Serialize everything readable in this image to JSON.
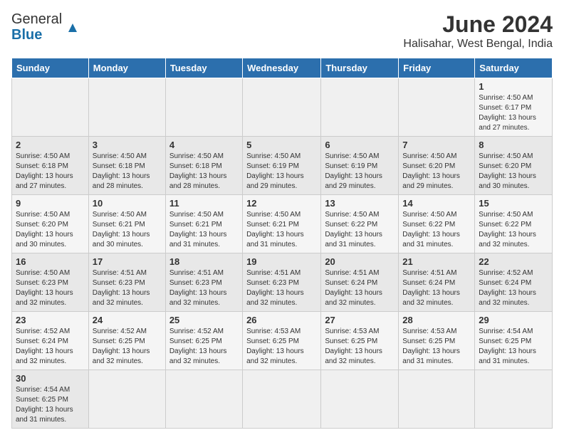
{
  "header": {
    "logo_line1": "General",
    "logo_line2": "Blue",
    "main_title": "June 2024",
    "subtitle": "Halisahar, West Bengal, India"
  },
  "weekdays": [
    "Sunday",
    "Monday",
    "Tuesday",
    "Wednesday",
    "Thursday",
    "Friday",
    "Saturday"
  ],
  "weeks": [
    [
      {
        "day": "",
        "info": ""
      },
      {
        "day": "",
        "info": ""
      },
      {
        "day": "",
        "info": ""
      },
      {
        "day": "",
        "info": ""
      },
      {
        "day": "",
        "info": ""
      },
      {
        "day": "",
        "info": ""
      },
      {
        "day": "1",
        "info": "Sunrise: 4:50 AM\nSunset: 6:17 PM\nDaylight: 13 hours\nand 27 minutes."
      }
    ],
    [
      {
        "day": "2",
        "info": "Sunrise: 4:50 AM\nSunset: 6:18 PM\nDaylight: 13 hours\nand 27 minutes."
      },
      {
        "day": "3",
        "info": "Sunrise: 4:50 AM\nSunset: 6:18 PM\nDaylight: 13 hours\nand 28 minutes."
      },
      {
        "day": "4",
        "info": "Sunrise: 4:50 AM\nSunset: 6:18 PM\nDaylight: 13 hours\nand 28 minutes."
      },
      {
        "day": "5",
        "info": "Sunrise: 4:50 AM\nSunset: 6:19 PM\nDaylight: 13 hours\nand 29 minutes."
      },
      {
        "day": "6",
        "info": "Sunrise: 4:50 AM\nSunset: 6:19 PM\nDaylight: 13 hours\nand 29 minutes."
      },
      {
        "day": "7",
        "info": "Sunrise: 4:50 AM\nSunset: 6:20 PM\nDaylight: 13 hours\nand 29 minutes."
      },
      {
        "day": "8",
        "info": "Sunrise: 4:50 AM\nSunset: 6:20 PM\nDaylight: 13 hours\nand 30 minutes."
      }
    ],
    [
      {
        "day": "9",
        "info": "Sunrise: 4:50 AM\nSunset: 6:20 PM\nDaylight: 13 hours\nand 30 minutes."
      },
      {
        "day": "10",
        "info": "Sunrise: 4:50 AM\nSunset: 6:21 PM\nDaylight: 13 hours\nand 30 minutes."
      },
      {
        "day": "11",
        "info": "Sunrise: 4:50 AM\nSunset: 6:21 PM\nDaylight: 13 hours\nand 31 minutes."
      },
      {
        "day": "12",
        "info": "Sunrise: 4:50 AM\nSunset: 6:21 PM\nDaylight: 13 hours\nand 31 minutes."
      },
      {
        "day": "13",
        "info": "Sunrise: 4:50 AM\nSunset: 6:22 PM\nDaylight: 13 hours\nand 31 minutes."
      },
      {
        "day": "14",
        "info": "Sunrise: 4:50 AM\nSunset: 6:22 PM\nDaylight: 13 hours\nand 31 minutes."
      },
      {
        "day": "15",
        "info": "Sunrise: 4:50 AM\nSunset: 6:22 PM\nDaylight: 13 hours\nand 32 minutes."
      }
    ],
    [
      {
        "day": "16",
        "info": "Sunrise: 4:50 AM\nSunset: 6:23 PM\nDaylight: 13 hours\nand 32 minutes."
      },
      {
        "day": "17",
        "info": "Sunrise: 4:51 AM\nSunset: 6:23 PM\nDaylight: 13 hours\nand 32 minutes."
      },
      {
        "day": "18",
        "info": "Sunrise: 4:51 AM\nSunset: 6:23 PM\nDaylight: 13 hours\nand 32 minutes."
      },
      {
        "day": "19",
        "info": "Sunrise: 4:51 AM\nSunset: 6:23 PM\nDaylight: 13 hours\nand 32 minutes."
      },
      {
        "day": "20",
        "info": "Sunrise: 4:51 AM\nSunset: 6:24 PM\nDaylight: 13 hours\nand 32 minutes."
      },
      {
        "day": "21",
        "info": "Sunrise: 4:51 AM\nSunset: 6:24 PM\nDaylight: 13 hours\nand 32 minutes."
      },
      {
        "day": "22",
        "info": "Sunrise: 4:52 AM\nSunset: 6:24 PM\nDaylight: 13 hours\nand 32 minutes."
      }
    ],
    [
      {
        "day": "23",
        "info": "Sunrise: 4:52 AM\nSunset: 6:24 PM\nDaylight: 13 hours\nand 32 minutes."
      },
      {
        "day": "24",
        "info": "Sunrise: 4:52 AM\nSunset: 6:25 PM\nDaylight: 13 hours\nand 32 minutes."
      },
      {
        "day": "25",
        "info": "Sunrise: 4:52 AM\nSunset: 6:25 PM\nDaylight: 13 hours\nand 32 minutes."
      },
      {
        "day": "26",
        "info": "Sunrise: 4:53 AM\nSunset: 6:25 PM\nDaylight: 13 hours\nand 32 minutes."
      },
      {
        "day": "27",
        "info": "Sunrise: 4:53 AM\nSunset: 6:25 PM\nDaylight: 13 hours\nand 32 minutes."
      },
      {
        "day": "28",
        "info": "Sunrise: 4:53 AM\nSunset: 6:25 PM\nDaylight: 13 hours\nand 31 minutes."
      },
      {
        "day": "29",
        "info": "Sunrise: 4:54 AM\nSunset: 6:25 PM\nDaylight: 13 hours\nand 31 minutes."
      }
    ],
    [
      {
        "day": "30",
        "info": "Sunrise: 4:54 AM\nSunset: 6:25 PM\nDaylight: 13 hours\nand 31 minutes."
      },
      {
        "day": "",
        "info": ""
      },
      {
        "day": "",
        "info": ""
      },
      {
        "day": "",
        "info": ""
      },
      {
        "day": "",
        "info": ""
      },
      {
        "day": "",
        "info": ""
      },
      {
        "day": "",
        "info": ""
      }
    ]
  ]
}
